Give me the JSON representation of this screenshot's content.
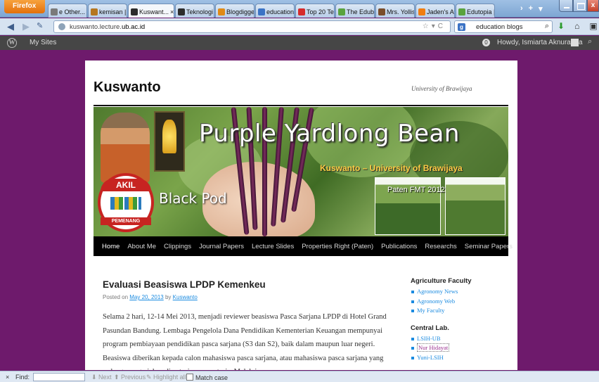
{
  "browser": {
    "app_button": "Firefox",
    "tabs": [
      {
        "label": "e Other...",
        "color": "#7a7a7a"
      },
      {
        "label": "kemisan | k...",
        "color": "#b5761f"
      },
      {
        "label": "Kuswant...",
        "color": "#2c2c2c",
        "active": true
      },
      {
        "label": "Teknologi I...",
        "color": "#2c2c2c"
      },
      {
        "label": "Blogdigger :...",
        "color": "#e08a15"
      },
      {
        "label": "education b...",
        "color": "#3b73c5"
      },
      {
        "label": "Top 20 Teac...",
        "color": "#d62b2b"
      },
      {
        "label": "The Edublo...",
        "color": "#5aa33e"
      },
      {
        "label": "Mrs. Yollis' ...",
        "color": "#7a4d2a"
      },
      {
        "label": "Jaden's Awe...",
        "color": "#f07d10"
      },
      {
        "label": "Edutopia | ...",
        "color": "#5aa33e"
      }
    ],
    "tab_close": "×",
    "tab_overflow": "›",
    "new_tab": "+",
    "tab_list": "▾",
    "window_close": "x",
    "back": "◀",
    "forward": "▶",
    "url_host": "kuswanto.lecture.",
    "url_domain": "ub.ac.id",
    "search_engine_letter": "g",
    "search_value": "education blogs"
  },
  "wp_admin": {
    "logo": "W",
    "my_sites": "My Sites",
    "notifications": "0",
    "howdy": "Howdy, Ismiarta Aknuranda",
    "search_icon": "search-icon"
  },
  "site": {
    "title": "Kuswanto",
    "description": "University of Brawijaya",
    "banner": {
      "title": "Purple Yardlong Bean",
      "subtitle": "Kuswanto – University of Brawijaya",
      "black_pod": "Black Pod",
      "paten": "Paten FMT 2012",
      "badge_top": "AKIL",
      "badge_bottom": "PEMENANG"
    },
    "menu": [
      "Home",
      "About Me",
      "Clippings",
      "Journal Papers",
      "Lecture Slides",
      "Properties Right (Paten)",
      "Publications",
      "Researchs",
      "Seminar Papers"
    ]
  },
  "post": {
    "title": "Evaluasi Beasiswa LPDP Kemenkeu",
    "posted_on": "Posted on",
    "date": "May 20, 2013",
    "by": "by",
    "author": "Kuswanto",
    "body": "Selama 2 hari, 12-14 Mei 2013, menjadi reviewer beasiswa Pasca Sarjana LPDP di Hotel Grand Pasundan Bandung.  Lembaga Pengelola Dana Pendidikan Kementerian Keuangan mempunyai program pembiayaan pendidikan pasca sarjana (S3 dan S2), baik dalam maupun luar negeri.  Beasiswa diberikan kepada calon mahasiswa pasca sarjana, atau mahasiswa pasca sarjana yang sedang mengerjakan disertasi maupun tesis.  Melalui"
  },
  "sidebar": {
    "widgets": [
      {
        "title": "Agriculture Faculty",
        "links": [
          "Agronomy News",
          "Agronomy Web",
          "My Faculty"
        ]
      },
      {
        "title": "Central Lab.",
        "links": [
          "LSIH-UB",
          "Nur Hidayat",
          "Yuni-LSIH"
        ]
      }
    ]
  },
  "findbar": {
    "close": "×",
    "label": "Find:",
    "value": "",
    "next": "Next",
    "previous": "Previous",
    "highlight": "Highlight all",
    "match_case": "Match case"
  }
}
